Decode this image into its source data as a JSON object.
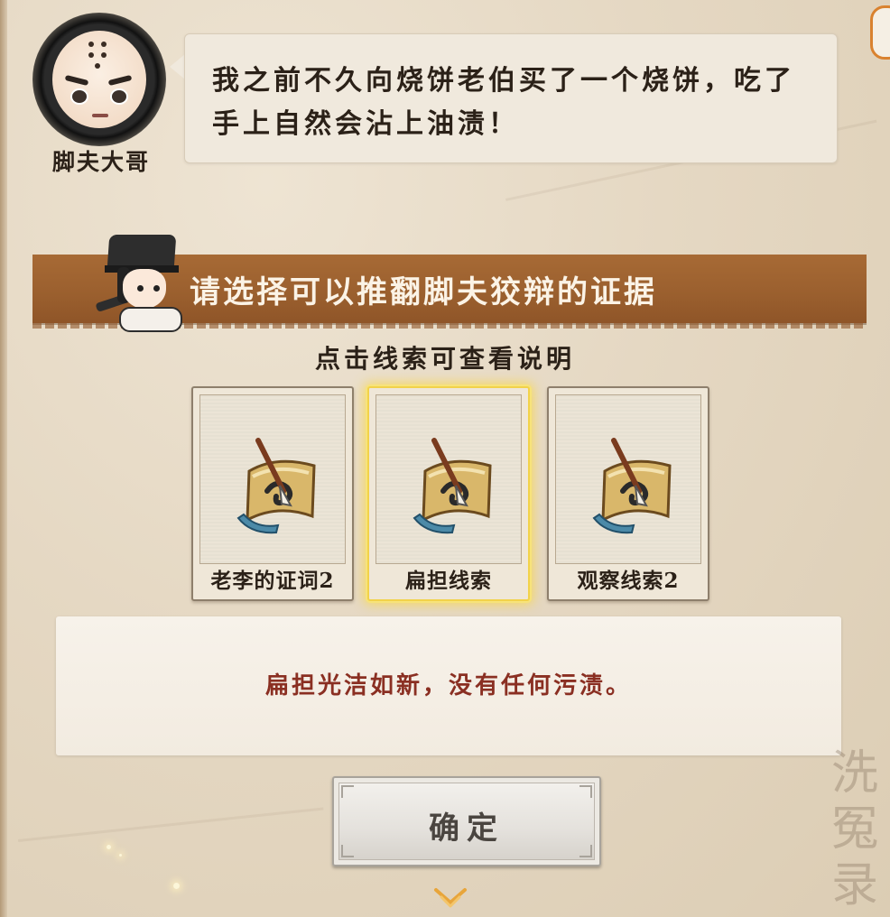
{
  "speaker": {
    "name": "脚夫大哥",
    "dialogue": "我之前不久向烧饼老伯买了一个烧饼，吃了手上自然会沾上油渍！"
  },
  "prompt": {
    "banner": "请选择可以推翻脚夫狡辩的证据",
    "hint": "点击线索可查看说明"
  },
  "clues": [
    {
      "label": "老李的证词2",
      "selected": false,
      "icon": "scroll-brush-icon"
    },
    {
      "label": "扁担线索",
      "selected": true,
      "icon": "scroll-brush-icon"
    },
    {
      "label": "观察线索2",
      "selected": false,
      "icon": "scroll-brush-icon"
    }
  ],
  "description": {
    "text": "扁担光洁如新，没有任何污渍。"
  },
  "confirm_label": "确定",
  "watermark": "洗冤录",
  "colors": {
    "banner": "#9a5f2e",
    "description_text": "#8a2f22",
    "selected_glow": "#f2d24a"
  }
}
